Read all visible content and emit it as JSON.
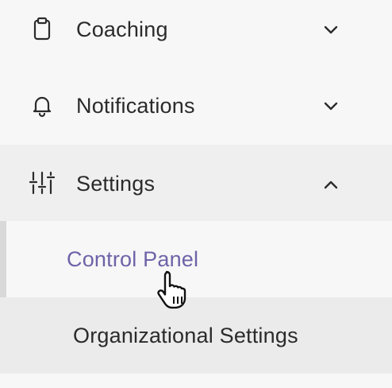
{
  "nav": {
    "items": [
      {
        "label": "Coaching",
        "icon": "clipboard-icon",
        "chevron": "chevron-down-icon"
      },
      {
        "label": "Notifications",
        "icon": "bell-icon",
        "chevron": "chevron-down-icon"
      },
      {
        "label": "Settings",
        "icon": "sliders-icon",
        "chevron": "chevron-up-icon",
        "expanded": true,
        "subitems": [
          {
            "label": "Control Panel",
            "active": true
          },
          {
            "label": "Organizational Settings",
            "active": false
          }
        ]
      }
    ]
  },
  "colors": {
    "active_text": "#6e63a8",
    "text": "#2b2b2b",
    "background": "#f7f7f7",
    "expanded_bg": "#efefef"
  },
  "cursor": {
    "icon": "hand-pointer-icon"
  }
}
